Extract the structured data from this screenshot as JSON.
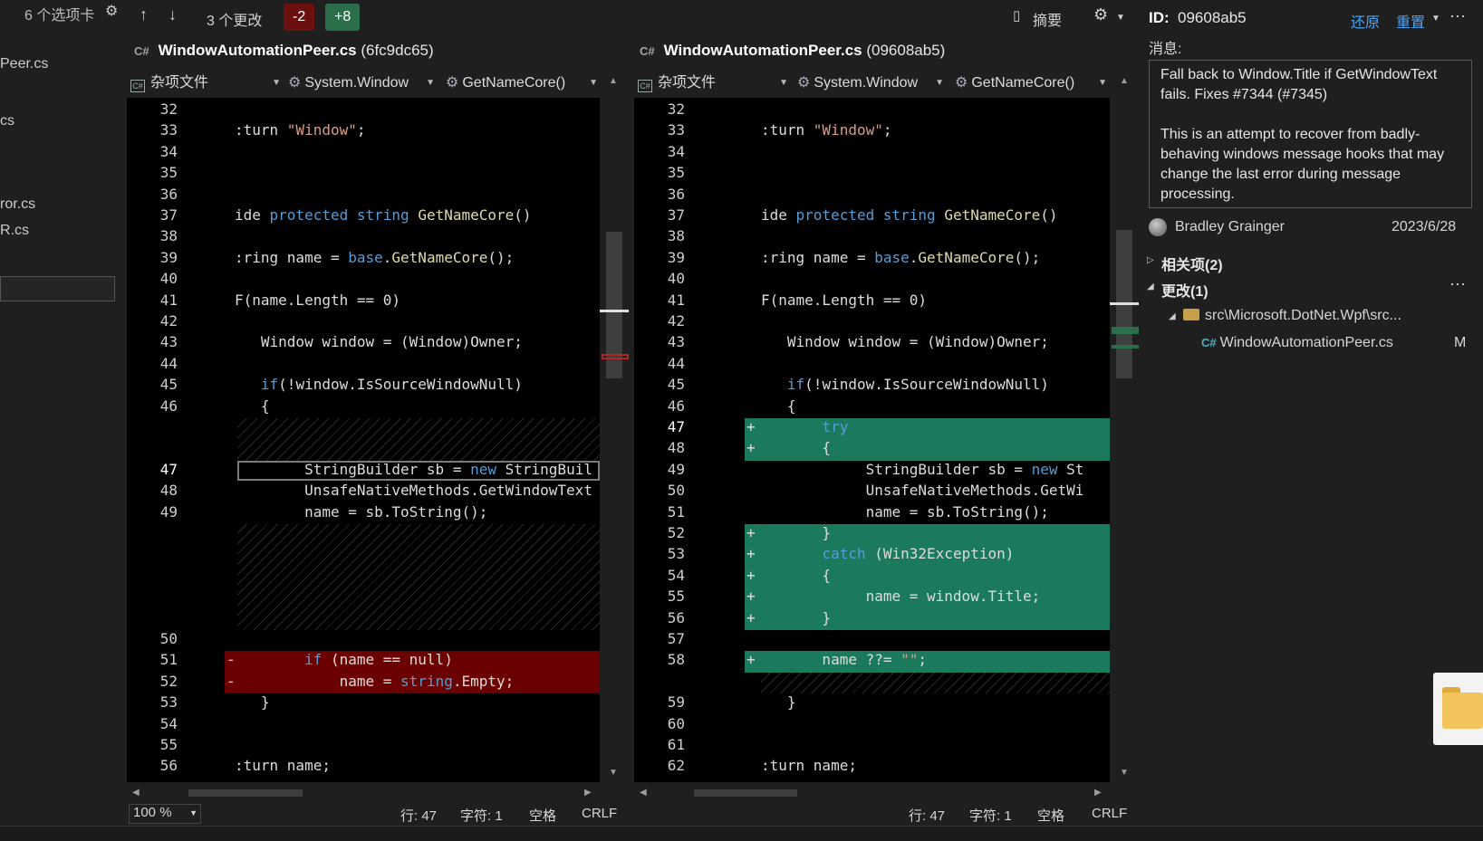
{
  "left": {
    "tabs_count": "6 个选项卡",
    "files": [
      "Peer.cs",
      "cs",
      "ror.cs",
      "R.cs"
    ]
  },
  "toolbar": {
    "up_icon": "arrow-up-icon",
    "down_icon": "arrow-down-icon",
    "changes_label": "3 个更改",
    "removed_badge": "-2",
    "added_badge": "+8",
    "summary_label": "摘要",
    "colors": {
      "removed": "#6b0f0f",
      "added": "#2a6e4a"
    }
  },
  "left_pane": {
    "title_file": "WindowAutomationPeer.cs",
    "title_hash": "(6fc9dc65)",
    "nav": [
      "杂项文件",
      "System.Window",
      "GetNameCore()"
    ],
    "status": {
      "zoom": "100 %",
      "line": "行: 47",
      "char": "字符: 1",
      "space": "空格",
      "eol": "CRLF"
    }
  },
  "right_pane": {
    "title_file": "WindowAutomationPeer.cs",
    "title_hash": "(09608ab5)",
    "nav": [
      "杂项文件",
      "System.Window",
      "GetNameCore()"
    ],
    "status": {
      "line": "行: 47",
      "char": "字符: 1",
      "space": "空格",
      "eol": "CRLF"
    }
  },
  "left_code": [
    {
      "n": "32",
      "t": ""
    },
    {
      "n": "33",
      "t": ":turn \"Window\";"
    },
    {
      "n": "34",
      "t": ""
    },
    {
      "n": "35",
      "t": ""
    },
    {
      "n": "36",
      "t": ""
    },
    {
      "n": "37",
      "t": "ide protected string GetNameCore()"
    },
    {
      "n": "38",
      "t": ""
    },
    {
      "n": "39",
      "t": ":ring name = base.GetNameCore();"
    },
    {
      "n": "40",
      "t": ""
    },
    {
      "n": "41",
      "t": "F(name.Length == 0)"
    },
    {
      "n": "42",
      "t": ""
    },
    {
      "n": "43",
      "t": "   Window window = (Window)Owner;"
    },
    {
      "n": "44",
      "t": ""
    },
    {
      "n": "45",
      "t": "   if(!window.IsSourceWindowNull)"
    },
    {
      "n": "46",
      "t": "   {"
    },
    {
      "n": "47",
      "t": "        StringBuilder sb = new StringBuil"
    },
    {
      "n": "48",
      "t": "        UnsafeNativeMethods.GetWindowText"
    },
    {
      "n": "49",
      "t": "        name = sb.ToString();"
    },
    {
      "n": "50",
      "t": ""
    },
    {
      "n": "51",
      "t": "        if (name == null)"
    },
    {
      "n": "52",
      "t": "            name = string.Empty;"
    },
    {
      "n": "53",
      "t": "   }"
    },
    {
      "n": "54",
      "t": ""
    },
    {
      "n": "55",
      "t": ""
    },
    {
      "n": "56",
      "t": ":turn name;"
    }
  ],
  "right_code": [
    {
      "n": "32",
      "t": ""
    },
    {
      "n": "33",
      "t": ":turn \"Window\";"
    },
    {
      "n": "34",
      "t": ""
    },
    {
      "n": "35",
      "t": ""
    },
    {
      "n": "36",
      "t": ""
    },
    {
      "n": "37",
      "t": "ide protected string GetNameCore()"
    },
    {
      "n": "38",
      "t": ""
    },
    {
      "n": "39",
      "t": ":ring name = base.GetNameCore();"
    },
    {
      "n": "40",
      "t": ""
    },
    {
      "n": "41",
      "t": "F(name.Length == 0)"
    },
    {
      "n": "42",
      "t": ""
    },
    {
      "n": "43",
      "t": "   Window window = (Window)Owner;"
    },
    {
      "n": "44",
      "t": ""
    },
    {
      "n": "45",
      "t": "   if(!window.IsSourceWindowNull)"
    },
    {
      "n": "46",
      "t": "   {"
    },
    {
      "n": "47",
      "t": "       try"
    },
    {
      "n": "48",
      "t": "       {"
    },
    {
      "n": "49",
      "t": "            StringBuilder sb = new St"
    },
    {
      "n": "50",
      "t": "            UnsafeNativeMethods.GetWi"
    },
    {
      "n": "51",
      "t": "            name = sb.ToString();"
    },
    {
      "n": "52",
      "t": "       }"
    },
    {
      "n": "53",
      "t": "       catch (Win32Exception)"
    },
    {
      "n": "54",
      "t": "       {"
    },
    {
      "n": "55",
      "t": "            name = window.Title;"
    },
    {
      "n": "56",
      "t": "       }"
    },
    {
      "n": "57",
      "t": ""
    },
    {
      "n": "58",
      "t": "       name ??= \"\";"
    },
    {
      "n": "59",
      "t": "   }"
    },
    {
      "n": "60",
      "t": ""
    },
    {
      "n": "61",
      "t": ""
    },
    {
      "n": "62",
      "t": ":turn name;"
    }
  ],
  "commit": {
    "id_label": "ID:",
    "id_value": "09608ab5",
    "revert_label": "还原",
    "reset_label": "重置",
    "message_label": "消息:",
    "message_p1": "Fall back to Window.Title if GetWindowText fails. Fixes #7344 (#7345)",
    "message_p2": "This is an attempt to recover from badly-behaving windows message hooks that may change the last error during message processing.",
    "author": "Bradley Grainger",
    "date": "2023/6/28",
    "related_label": "相关项(2)",
    "changes_label": "更改(1)",
    "folder_path": "src\\Microsoft.DotNet.Wpf\\src...",
    "changed_file": "WindowAutomationPeer.cs",
    "changed_status": "M"
  }
}
